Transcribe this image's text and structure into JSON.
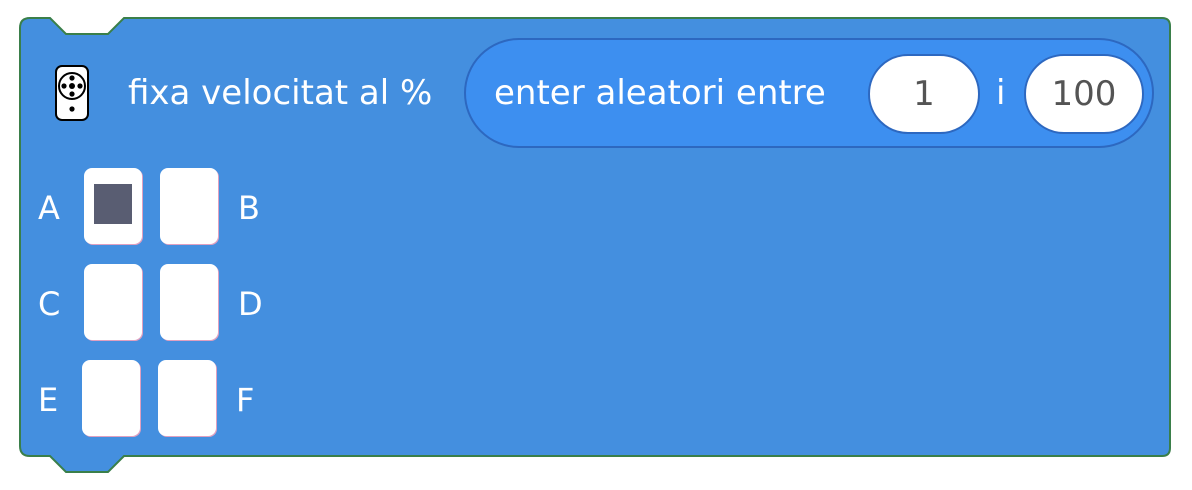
{
  "block": {
    "colors": {
      "block_fill": "#448fdf",
      "block_stroke": "#3a7f4a",
      "reporter_fill": "#3d8ff0",
      "field_text": "#545454"
    },
    "icon": "motor-icon",
    "label": "fixa velocitat al %",
    "reporter": {
      "label": "enter aleatori entre",
      "min_value": "1",
      "separator": "i",
      "max_value": "100"
    },
    "ports": [
      {
        "letter": "A",
        "selected": true
      },
      {
        "letter": "B",
        "selected": false
      },
      {
        "letter": "C",
        "selected": false
      },
      {
        "letter": "D",
        "selected": false
      },
      {
        "letter": "E",
        "selected": false
      },
      {
        "letter": "F",
        "selected": false
      }
    ]
  }
}
